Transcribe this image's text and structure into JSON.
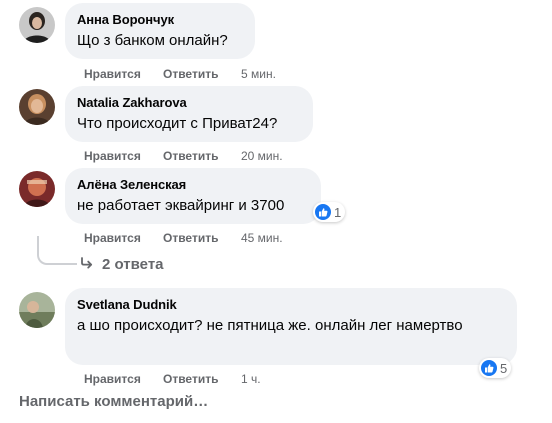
{
  "comments": [
    {
      "author": "Анна Ворончук",
      "text": "Що з банком онлайн?",
      "like": "Нравится",
      "reply": "Ответить",
      "time": "5 мин."
    },
    {
      "author": "Natalia Zakharova",
      "text": "Что происходит с Приват24?",
      "like": "Нравится",
      "reply": "Ответить",
      "time": "20 мин."
    },
    {
      "author": "Алёна Зеленская",
      "text": "не работает эквайринг и 3700",
      "like": "Нравится",
      "reply": "Ответить",
      "time": "45 мин.",
      "reaction_count": "1"
    },
    {
      "author": "Svetlana Dudnik",
      "text": "а шо происходит? не пятница же. онлайн лег намертво",
      "like": "Нравится",
      "reply": "Ответить",
      "time": "1 ч.",
      "reaction_count": "5"
    }
  ],
  "replies_label": "2 ответа",
  "write_placeholder": "Написать комментарий…",
  "colors": {
    "bubble": "#f0f2f5",
    "secondary_text": "#65676b",
    "like_blue": "#1877f2"
  },
  "icons": {
    "reaction": "thumbs-up-icon",
    "replies": "reply-arrow-icon"
  }
}
